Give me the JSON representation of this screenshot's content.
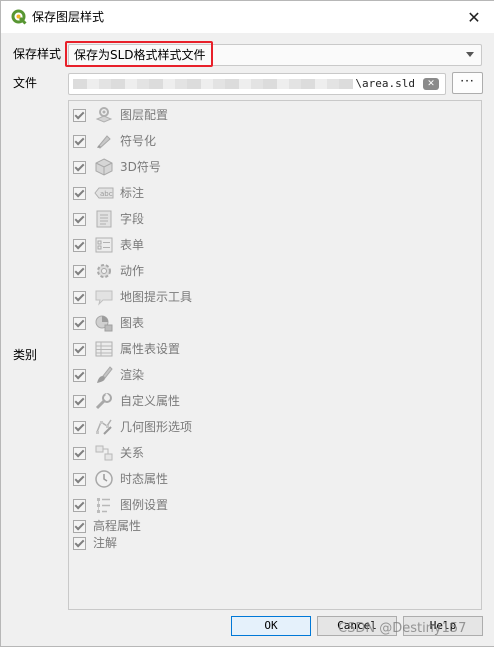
{
  "window": {
    "title": "保存图层样式",
    "close_glyph": "✕"
  },
  "form": {
    "style_label": "保存样式",
    "style_value": "保存为SLD格式样式文件",
    "file_label": "文件",
    "file_value": "\\area.sld",
    "browse_label": "···",
    "category_label": "类别"
  },
  "categories": [
    {
      "label": "图层配置",
      "icon": "layer-config-icon",
      "checked": true
    },
    {
      "label": "符号化",
      "icon": "symbology-icon",
      "checked": true
    },
    {
      "label": "3D符号",
      "icon": "cube-3d-icon",
      "checked": true
    },
    {
      "label": "标注",
      "icon": "label-abc-icon",
      "checked": true
    },
    {
      "label": "字段",
      "icon": "fields-icon",
      "checked": true
    },
    {
      "label": "表单",
      "icon": "form-icon",
      "checked": true
    },
    {
      "label": "动作",
      "icon": "action-gear-icon",
      "checked": true
    },
    {
      "label": "地图提示工具",
      "icon": "map-tip-icon",
      "checked": true
    },
    {
      "label": "图表",
      "icon": "diagram-icon",
      "checked": true
    },
    {
      "label": "属性表设置",
      "icon": "attribute-table-icon",
      "checked": true
    },
    {
      "label": "渲染",
      "icon": "rendering-brush-icon",
      "checked": true
    },
    {
      "label": "自定义属性",
      "icon": "custom-properties-icon",
      "checked": true
    },
    {
      "label": "几何图形选项",
      "icon": "geometry-options-icon",
      "checked": true
    },
    {
      "label": "关系",
      "icon": "relations-icon",
      "checked": true
    },
    {
      "label": "时态属性",
      "icon": "clock-icon",
      "checked": true
    },
    {
      "label": "图例设置",
      "icon": "legend-icon",
      "checked": true
    },
    {
      "label": "高程属性",
      "icon": "",
      "checked": true
    },
    {
      "label": "注解",
      "icon": "",
      "checked": true
    }
  ],
  "buttons": {
    "ok": "OK",
    "cancel": "Cancel",
    "help": "Help"
  },
  "watermark": "CSDN @Destiny157",
  "colors": {
    "highlight": "#e8202a",
    "qgis_green": "#589632",
    "ok_border": "#0078d7"
  }
}
